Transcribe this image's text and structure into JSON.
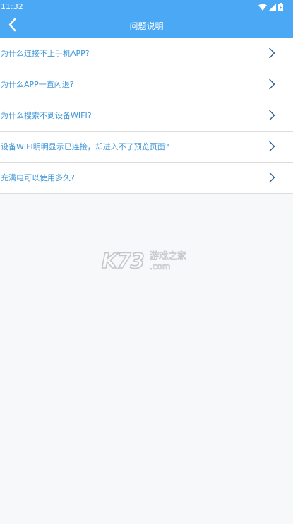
{
  "status_bar": {
    "time": "11:32",
    "icons": [
      "wifi-icon",
      "signal-icon",
      "battery-icon"
    ]
  },
  "nav": {
    "title": "问题说明",
    "back_icon": "chevron-left-icon"
  },
  "faq": [
    {
      "question": "为什么连接不上手机APP?"
    },
    {
      "question": "为什么APP一直闪退?"
    },
    {
      "question": "为什么搜索不到设备WIFI?"
    },
    {
      "question": "设备WIFI明明显示已连接，却进入不了预览页面?"
    },
    {
      "question": "充满电可以使用多久?"
    }
  ],
  "watermark": {
    "logo": "K73",
    "chinese": "游戏之家",
    "domain": ".com"
  },
  "colors": {
    "header": "#4aa8f5",
    "question_text": "#4096d8",
    "chevron": "#2f5f8a",
    "page_background": "#f7f8f9",
    "divider": "#dddddd"
  }
}
